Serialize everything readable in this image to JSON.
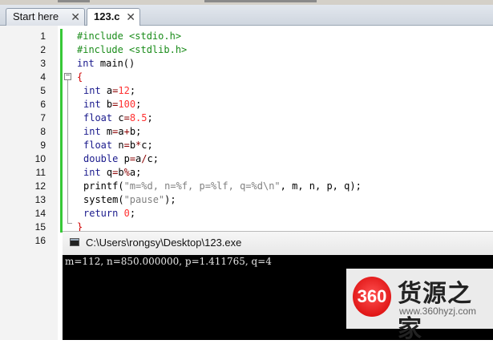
{
  "tabs": [
    {
      "label": "Start here",
      "active": false
    },
    {
      "label": "123.c",
      "active": true
    }
  ],
  "close_glyph": "✕",
  "editor": {
    "lines": [
      {
        "n": "1",
        "parts": [
          [
            "pp",
            "#include <stdio.h>"
          ]
        ]
      },
      {
        "n": "2",
        "parts": [
          [
            "pp",
            "#include <stdlib.h>"
          ]
        ]
      },
      {
        "n": "3",
        "parts": [
          [
            "kw",
            "int"
          ],
          [
            "",
            " main()"
          ]
        ]
      },
      {
        "n": "4",
        "parts": [
          [
            "brace",
            "{"
          ]
        ]
      },
      {
        "n": "5",
        "parts": [
          [
            "kw",
            "int"
          ],
          [
            "",
            " a"
          ],
          [
            "op",
            "="
          ],
          [
            "num-c",
            "12"
          ],
          [
            "",
            ";"
          ]
        ]
      },
      {
        "n": "6",
        "parts": [
          [
            "kw",
            "int"
          ],
          [
            "",
            " b"
          ],
          [
            "op",
            "="
          ],
          [
            "num-c",
            "100"
          ],
          [
            "",
            ";"
          ]
        ]
      },
      {
        "n": "7",
        "parts": [
          [
            "kw",
            "float"
          ],
          [
            "",
            " c"
          ],
          [
            "op",
            "="
          ],
          [
            "num-c",
            "8.5"
          ],
          [
            "",
            ";"
          ]
        ]
      },
      {
        "n": "8",
        "parts": [
          [
            "kw",
            "int"
          ],
          [
            "",
            " m"
          ],
          [
            "op",
            "="
          ],
          [
            "",
            "a"
          ],
          [
            "op",
            "+"
          ],
          [
            "",
            "b;"
          ]
        ]
      },
      {
        "n": "9",
        "parts": [
          [
            "kw",
            "float"
          ],
          [
            "",
            " n"
          ],
          [
            "op",
            "="
          ],
          [
            "",
            "b"
          ],
          [
            "op",
            "*"
          ],
          [
            "",
            "c;"
          ]
        ]
      },
      {
        "n": "10",
        "parts": [
          [
            "kw",
            "double"
          ],
          [
            "",
            " p"
          ],
          [
            "op",
            "="
          ],
          [
            "",
            "a"
          ],
          [
            "op",
            "/"
          ],
          [
            "",
            "c;"
          ]
        ]
      },
      {
        "n": "11",
        "parts": [
          [
            "kw",
            "int"
          ],
          [
            "",
            " q"
          ],
          [
            "op",
            "="
          ],
          [
            "",
            "b"
          ],
          [
            "op",
            "%"
          ],
          [
            "",
            "a;"
          ]
        ]
      },
      {
        "n": "12",
        "parts": [
          [
            "",
            "printf("
          ],
          [
            "str",
            "\"m=%d, n=%f, p=%lf, q=%d\\n\""
          ],
          [
            "",
            ", m, n, p, q);"
          ]
        ]
      },
      {
        "n": "13",
        "parts": [
          [
            "",
            "system("
          ],
          [
            "str",
            "\"pause\""
          ],
          [
            "",
            ");"
          ]
        ]
      },
      {
        "n": "14",
        "parts": [
          [
            "kw",
            "return"
          ],
          [
            "",
            " "
          ],
          [
            "num-c",
            "0"
          ],
          [
            "",
            ";"
          ]
        ]
      },
      {
        "n": "15",
        "parts": [
          [
            "brace",
            "}"
          ]
        ]
      },
      {
        "n": "16",
        "parts": []
      }
    ]
  },
  "console": {
    "title": "C:\\Users\\rongsy\\Desktop\\123.exe",
    "output": "m=112, n=850.000000, p=1.411765, q=4"
  },
  "watermark": {
    "logo": "360",
    "title": "货源之家",
    "url": "www.360hyzj.com"
  }
}
